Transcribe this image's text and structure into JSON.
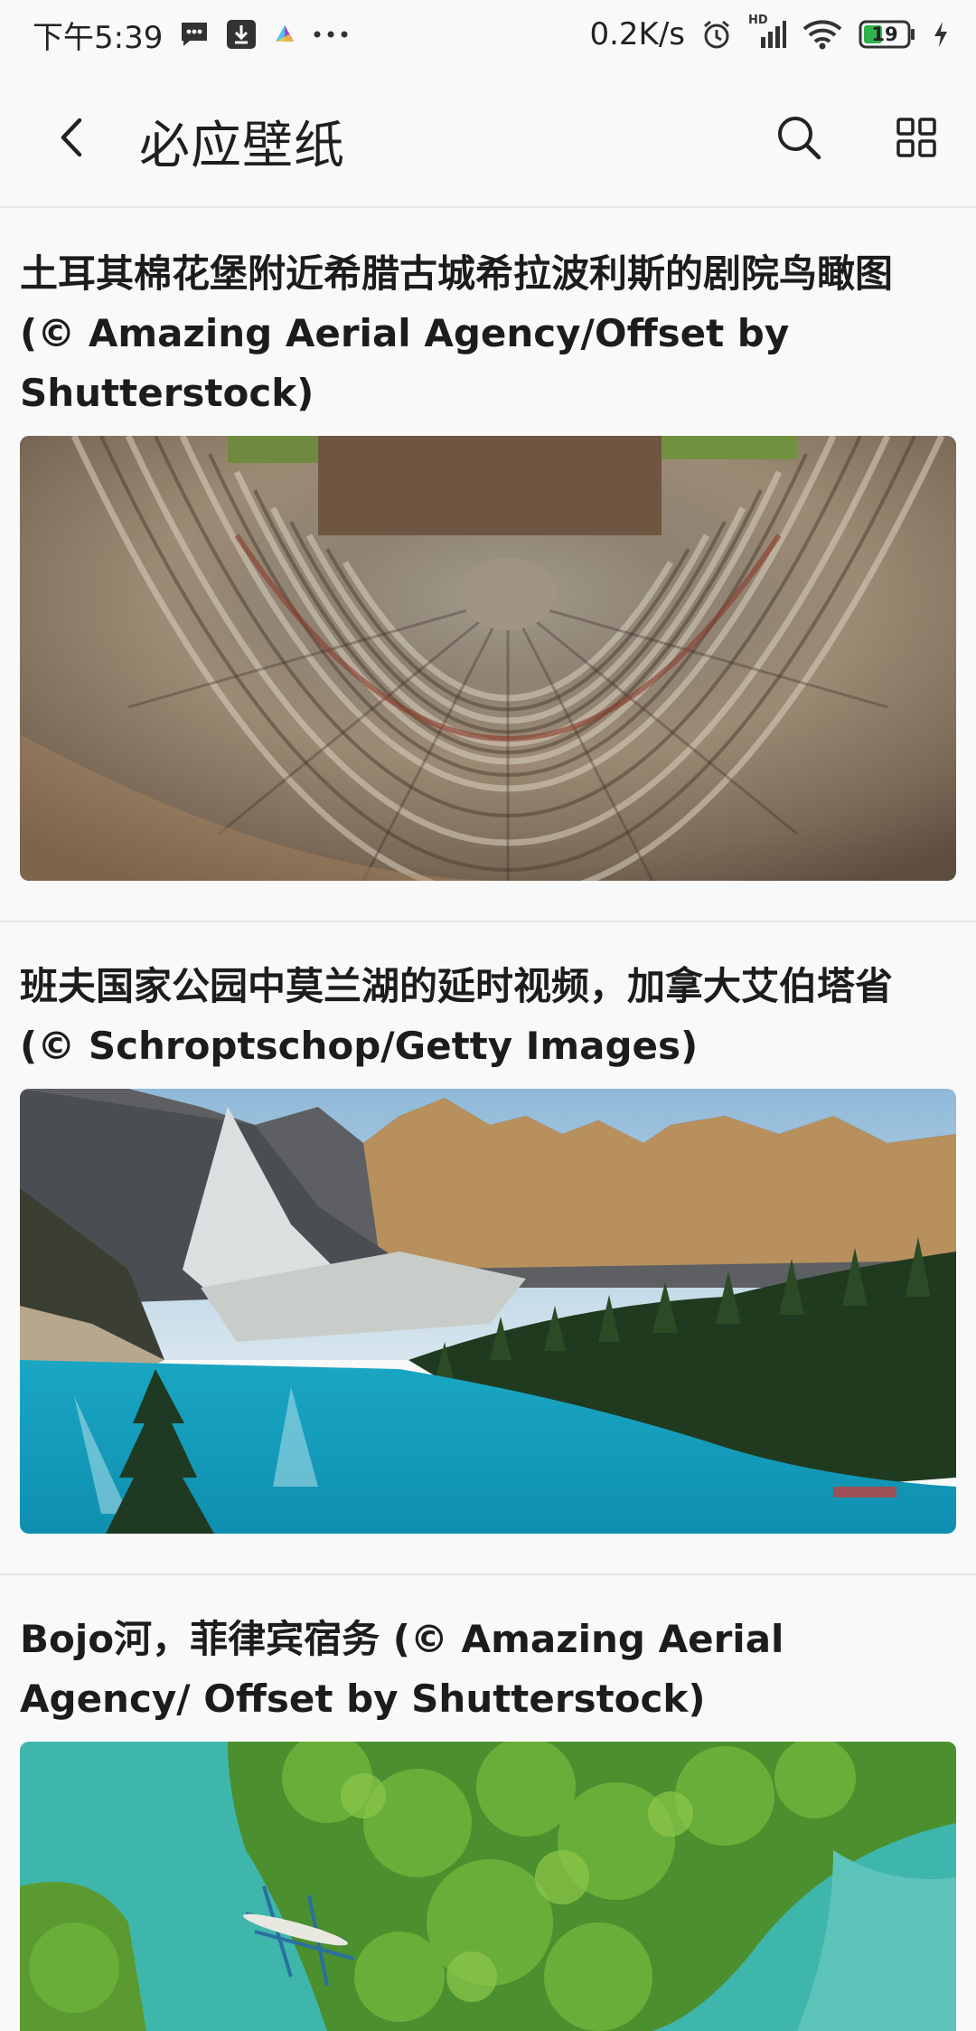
{
  "status_bar": {
    "time": "下午5:39",
    "network_speed": "0.2K/s",
    "signal_label": "HD",
    "battery_level": "19",
    "icons": [
      "message-icon",
      "download-icon",
      "app-notification-icon",
      "more-dots-icon",
      "alarm-icon",
      "signal-icon",
      "wifi-icon",
      "battery-icon",
      "charging-icon"
    ]
  },
  "app_bar": {
    "title": "必应壁纸",
    "icons": [
      "back-arrow-icon",
      "search-icon",
      "grid-view-icon"
    ]
  },
  "wallpapers": [
    {
      "title": "土耳其棉花堡附近希腊古城希拉波利斯的剧院鸟瞰图 (© Amazing Aerial Agency/Offset by Shutterstock)",
      "image": "amphitheater-aerial-photo"
    },
    {
      "title": "班夫国家公园中莫兰湖的延时视频，加拿大艾伯塔省 (© Schroptschop/Getty Images)",
      "image": "moraine-lake-photo"
    },
    {
      "title": "Bojo河，菲律宾宿务 (© Amazing Aerial Agency/ Offset by Shutterstock)",
      "image": "bojo-river-aerial-photo"
    }
  ],
  "colors": {
    "background": "#f9f9f9",
    "divider": "#e6e6e6",
    "text": "#1c1c1c",
    "battery": "#2fb24c"
  }
}
